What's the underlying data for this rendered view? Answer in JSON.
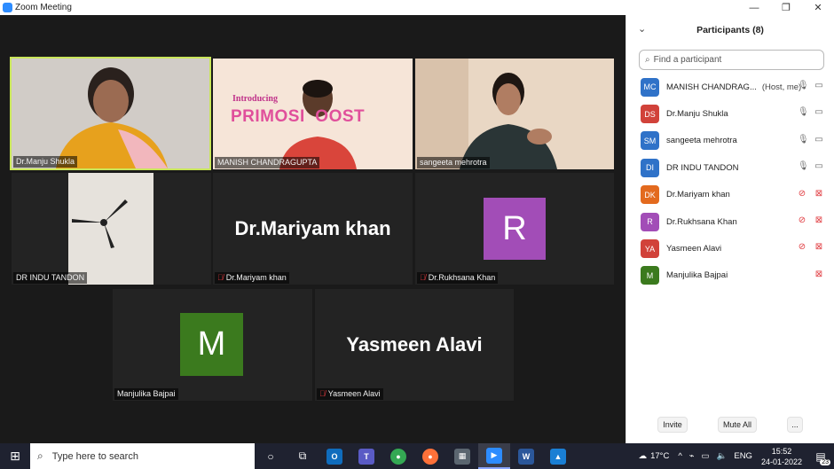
{
  "window": {
    "title": "Zoom Meeting",
    "controls": [
      "—",
      "❐",
      "✕"
    ]
  },
  "tiles": [
    {
      "name": "Dr.Manju Shukla",
      "muted": false,
      "kind": "video"
    },
    {
      "name": "MANISH CHANDRAGUPTA",
      "muted": false,
      "kind": "video",
      "banner_top": "Introducing",
      "banner_brand": "PRIMOSI  OOST"
    },
    {
      "name": "sangeeta  mehrotra",
      "muted": false,
      "kind": "video"
    },
    {
      "name": "DR INDU TANDON",
      "muted": false,
      "kind": "video"
    },
    {
      "name": "Dr.Mariyam khan",
      "muted": true,
      "kind": "text",
      "big": "Dr.Mariyam khan"
    },
    {
      "name": "Dr.Rukhsana Khan",
      "muted": true,
      "kind": "avatar",
      "letter": "R",
      "color": "#a24db7"
    },
    {
      "name": "Manjulika Bajpai",
      "muted": false,
      "kind": "avatar",
      "letter": "M",
      "color": "#3b7a1e"
    },
    {
      "name": "Yasmeen Alavi",
      "muted": true,
      "kind": "text",
      "big": "Yasmeen Alavi"
    }
  ],
  "participants_panel": {
    "title": "Participants (8)",
    "search_placeholder": "Find a participant",
    "participants": [
      {
        "initials": "MC",
        "name": "MANISH CHANDRAG...",
        "tag": "(Host, me)",
        "color": "#2f72c8",
        "mic": "on",
        "video": "on"
      },
      {
        "initials": "DS",
        "name": "Dr.Manju Shukla",
        "tag": "",
        "color": "#d1423a",
        "mic": "on",
        "video": "on"
      },
      {
        "initials": "SM",
        "name": "sangeeta  mehrotra",
        "tag": "",
        "color": "#2f72c8",
        "mic": "active",
        "video": "on"
      },
      {
        "initials": "DI",
        "name": "DR INDU TANDON",
        "tag": "",
        "color": "#2f72c8",
        "mic": "on",
        "video": "on"
      },
      {
        "initials": "DK",
        "name": "Dr.Mariyam khan",
        "tag": "",
        "color": "#e36a1e",
        "mic": "off",
        "video": "off"
      },
      {
        "initials": "R",
        "name": "Dr.Rukhsana Khan",
        "tag": "",
        "color": "#a24db7",
        "mic": "off",
        "video": "off"
      },
      {
        "initials": "YA",
        "name": "Yasmeen Alavi",
        "tag": "",
        "color": "#d1423a",
        "mic": "off",
        "video": "off"
      },
      {
        "initials": "M",
        "name": "Manjulika Bajpai",
        "tag": "",
        "color": "#3b7a1e",
        "mic": "none",
        "video": "off"
      }
    ],
    "footer": {
      "invite": "Invite",
      "mute_all": "Mute All",
      "more": "..."
    }
  },
  "taskbar": {
    "search_placeholder": "Type here to search",
    "apps": [
      "Outlook",
      "Teams",
      "Chrome",
      "Firefox",
      "Calculator",
      "Zoom",
      "Word",
      "Photos"
    ],
    "weather": "17°C",
    "language": "ENG",
    "time": "15:52",
    "date": "24-01-2022",
    "notifications": "23"
  }
}
